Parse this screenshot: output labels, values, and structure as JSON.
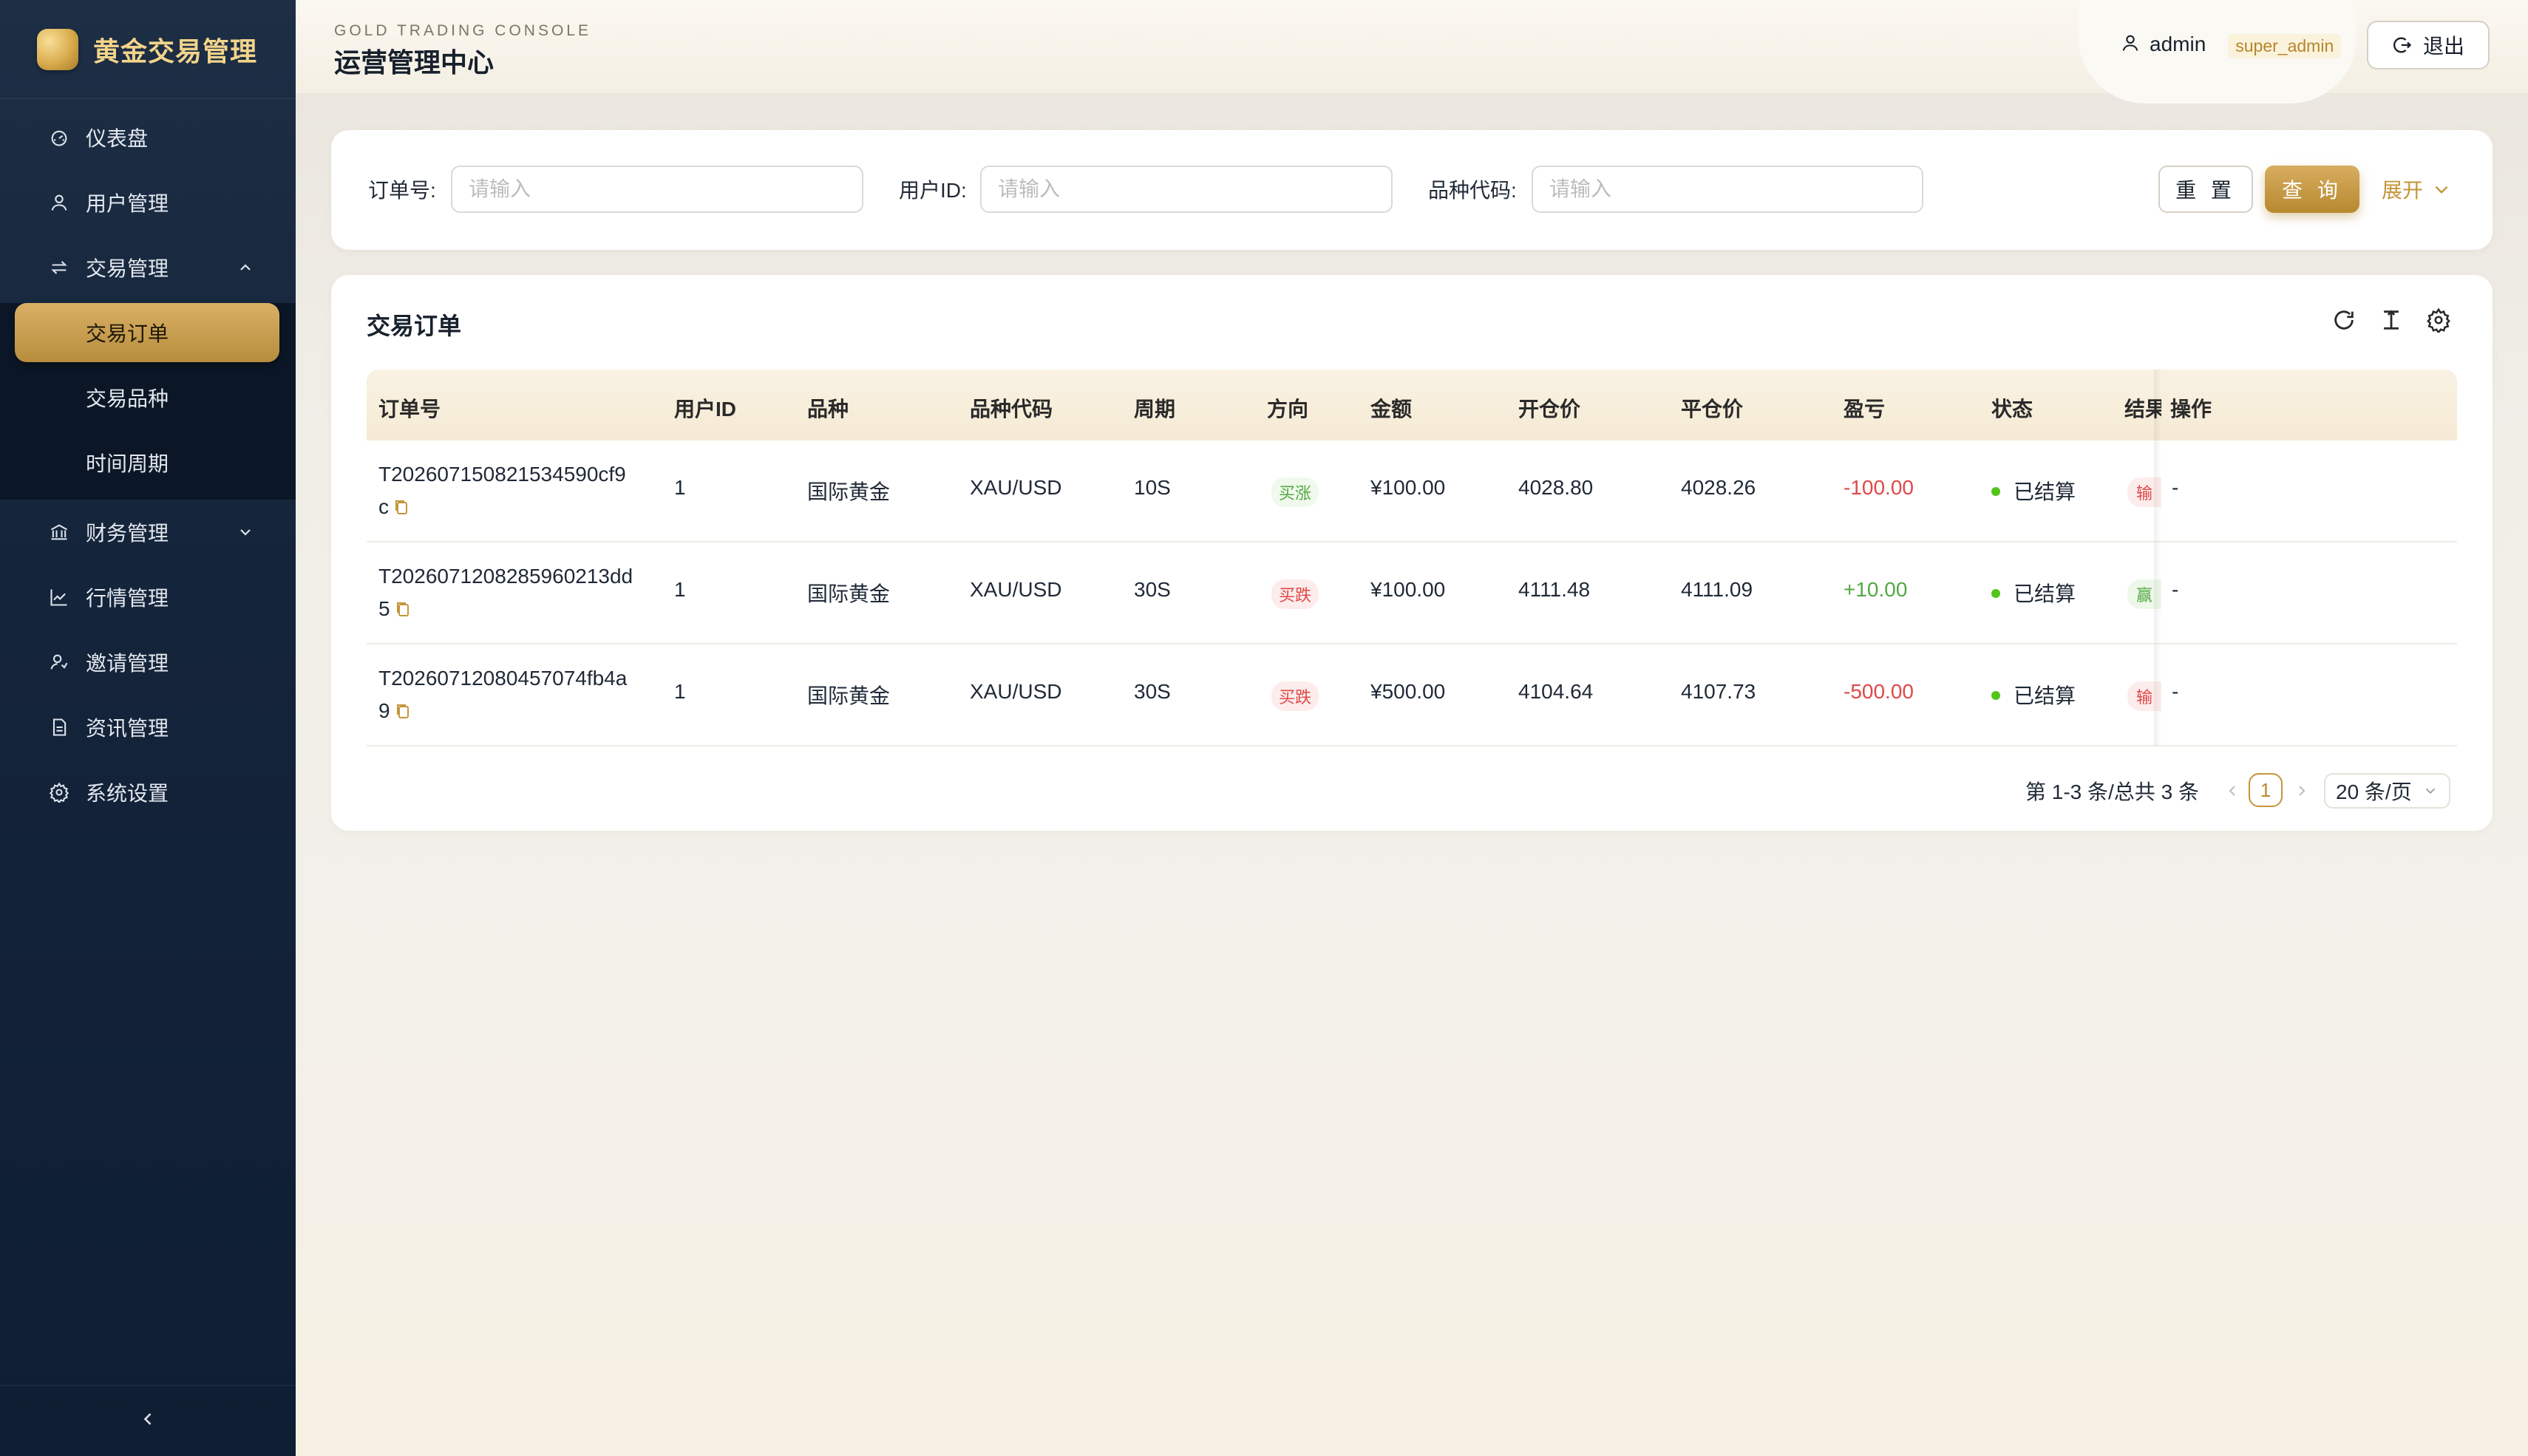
{
  "brand": {
    "name": "黄金交易管理"
  },
  "sidebar": {
    "items": [
      {
        "label": "仪表盘",
        "icon": "dashboard-icon"
      },
      {
        "label": "用户管理",
        "icon": "user-icon"
      },
      {
        "label": "交易管理",
        "icon": "swap-icon",
        "expanded": true,
        "children": [
          {
            "label": "交易订单",
            "active": true
          },
          {
            "label": "交易品种"
          },
          {
            "label": "时间周期"
          }
        ]
      },
      {
        "label": "财务管理",
        "icon": "bank-icon",
        "expanded": false
      },
      {
        "label": "行情管理",
        "icon": "line-chart-icon"
      },
      {
        "label": "邀请管理",
        "icon": "invite-icon"
      },
      {
        "label": "资讯管理",
        "icon": "document-icon"
      },
      {
        "label": "系统设置",
        "icon": "gear-icon"
      }
    ],
    "collapse_icon": "chevron-left-icon"
  },
  "header": {
    "subtitle": "GOLD TRADING CONSOLE",
    "title": "运营管理中心",
    "user": {
      "name": "admin",
      "role": "super_admin"
    },
    "logout_label": "退出"
  },
  "search": {
    "fields": [
      {
        "label": "订单号:",
        "placeholder": "请输入"
      },
      {
        "label": "用户ID:",
        "placeholder": "请输入"
      },
      {
        "label": "品种代码:",
        "placeholder": "请输入"
      }
    ],
    "reset_label": "重 置",
    "query_label": "查 询",
    "expand_label": "展开"
  },
  "table": {
    "title": "交易订单",
    "columns": [
      "订单号",
      "用户ID",
      "品种",
      "品种代码",
      "周期",
      "方向",
      "金额",
      "开仓价",
      "平仓价",
      "盈亏",
      "状态",
      "结果",
      "操作"
    ],
    "rows": [
      {
        "order_no_line1": "T202607150821534590cf9",
        "order_no_line2": "c",
        "user_id": "1",
        "product": "国际黄金",
        "code": "XAU/USD",
        "period": "10S",
        "direction": "买涨",
        "direction_type": "up",
        "amount": "¥100.00",
        "open": "4028.80",
        "close": "4028.26",
        "pnl": "-100.00",
        "pnl_type": "neg",
        "status": "已结算",
        "result": "输",
        "result_type": "lose",
        "action": "-"
      },
      {
        "order_no_line1": "T2026071208285960213dd",
        "order_no_line2": "5",
        "user_id": "1",
        "product": "国际黄金",
        "code": "XAU/USD",
        "period": "30S",
        "direction": "买跌",
        "direction_type": "down",
        "amount": "¥100.00",
        "open": "4111.48",
        "close": "4111.09",
        "pnl": "+10.00",
        "pnl_type": "pos",
        "status": "已结算",
        "result": "赢",
        "result_type": "win",
        "action": "-"
      },
      {
        "order_no_line1": "T20260712080457074fb4a",
        "order_no_line2": "9",
        "user_id": "1",
        "product": "国际黄金",
        "code": "XAU/USD",
        "period": "30S",
        "direction": "买跌",
        "direction_type": "down",
        "amount": "¥500.00",
        "open": "4104.64",
        "close": "4107.73",
        "pnl": "-500.00",
        "pnl_type": "neg",
        "status": "已结算",
        "result": "输",
        "result_type": "lose",
        "action": "-"
      }
    ],
    "pagination": {
      "info": "第 1-3 条/总共 3 条",
      "current_page": "1",
      "page_size": "20 条/页"
    }
  },
  "colors": {
    "gold_accent": "#c4963a",
    "sidebar_bg": "#14243a",
    "loss_red": "#e04848",
    "profit_green": "#52a843"
  }
}
